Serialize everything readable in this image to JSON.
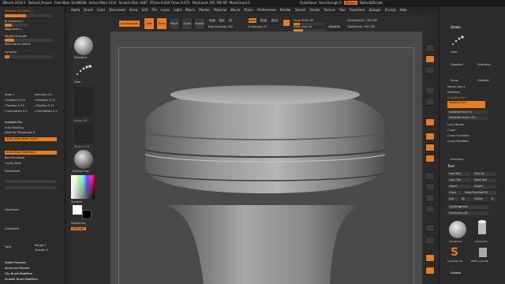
{
  "title_bar": {
    "app": "ZBrush 2018.1",
    "project": "Default_Project",
    "free_mem": "Free Mem 16.896GB",
    "active_mem": "Active Mem 7224",
    "scratch_disk": "Scratch Disk 3487",
    "timer": "ZTime 0.620 Timer 0.075",
    "polycount": "PolyCount 195.782 KP",
    "meshcount": "MeshCount 1",
    "quicksave": "QuickSave",
    "see_through": "See-through 0",
    "menus_btn": "Menus",
    "script": "DefaultZScript"
  },
  "menu_items": [
    "Alpha",
    "Brush",
    "Color",
    "Document",
    "Draw",
    "Edit",
    "File",
    "Layer",
    "Light",
    "Macro",
    "Marker",
    "Material",
    "Movie",
    "Picker",
    "Preferences",
    "Render",
    "Stencil",
    "Stroke",
    "Texture",
    "Tool",
    "Transform",
    "Zplugin",
    "Zscript",
    "Help"
  ],
  "left_panel": {
    "top_label": "Strength Multiplier 1",
    "rows": [
      {
        "text": "Brushalpha 0",
        "y": 19
      },
      {
        "text": "Magnitude 1",
        "y": 22
      },
      {
        "text": "Momentum Hold 8",
        "y": 34
      }
    ],
    "section1": "Wiggle Strength",
    "section2": "Dynamic",
    "sliders": [
      {
        "left": "Scale 1",
        "right": "Intensity 0.4"
      },
      {
        "left": "I Ambient 0.25",
        "right": "I Ambient 0.25"
      },
      {
        "left": "I Position 0.25",
        "right": "I Position 0.25"
      },
      {
        "left": "I Orientation 0.2",
        "right": "I Orientation 0.2"
      }
    ],
    "sculptris_pro": "Sculptris Pro",
    "auto_masking": "Auto Masking",
    "mask_by_polygroups": "Mask By Polygroups 0",
    "mask_mesh_insert": "Auto Mask Mesh Insert",
    "mask_fibermesh": "Auto Mask FiberMesh",
    "backface_mask": "BackFaceMask",
    "cavity_mask": "Cavity Mask",
    "directional": "Directional",
    "fibermesh": "FiberMesh",
    "colormask": "ColorMask",
    "twist_label": "Twist",
    "range_label": "Range 5",
    "smooth_label": "Smooth 5",
    "tablet_pressure": "Tablet Pressure",
    "alpha_texture": "Alpha and Texture",
    "clip_brush": "Clip Brush Modifiers",
    "smooth_brush": "Smooth Brush Modifiers"
  },
  "toolbar": {
    "home_page": "Home Page",
    "lightbox": "LightBox",
    "live_boolean": "Live Boolean",
    "edit": "Edit",
    "draw": "Draw",
    "move": "Move",
    "scale": "Scale",
    "rotate": "Rotate",
    "mrgb": "Mrgb",
    "rgb": "Rgb",
    "m": "M",
    "zadd": "Zadd",
    "zsub": "Zsub",
    "zcut": "Zcut",
    "rgb_intensity": "Rgb Intensity 100",
    "z_intensity": "Z Intensity 25",
    "focal_shift": "Focal Shift -55",
    "draw_size": "Draw Size 44",
    "dynamic": "Dynamic",
    "active_points": "ActivePoints: 195.782",
    "total_points": "TotalPoints: 195.782"
  },
  "tool_shelf": {
    "brush_name": "Standard",
    "stroke_name": "Dots",
    "alpha_name": "Alpha Off",
    "texture_name": "Texture Off",
    "material_name": "MatCap Gray",
    "gradient": "Gradient",
    "switch_color": "SwitchColor",
    "alternate": "Alternate"
  },
  "right_dock": [
    "BPR",
    "SPix 3",
    "Persp",
    "Floor",
    "Local",
    "Frame",
    "Move",
    "Zoom3D",
    "Rotate",
    "PolyF",
    "Transp",
    "Solo",
    "Xpose"
  ],
  "right_panel": {
    "stroke_title": "Stroke",
    "dots_label": "Dots",
    "drag_rect": "DragRect",
    "freehand": "FreeHand",
    "spray": "Spray",
    "dragdot": "DragDot",
    "color_label": "Color",
    "mouse_avg": "Mouse Avg 4",
    "modifiers": "Modifiers",
    "sculptris_pro": "Sculptris Pro",
    "adaptive_size": "Adaptive Size",
    "subdivision_size": "SubDivide Size 10",
    "undivision": "UnDivide Factor 1.25",
    "lazy_mouse": "Lazy Mouse",
    "curve": "Curve",
    "curve_functions": "Curve Functions",
    "curve_modifiers": "Curve Modifiers",
    "inventory": "Inventory",
    "tool_title": "Tool",
    "load_tool": "Load Tool",
    "save_as": "Save As",
    "copy_tool": "Copy Tool",
    "paste_tool": "Paste Tool",
    "import": "Import",
    "export": "Export",
    "clone": "Clone",
    "make_polymesh": "Make PolyMesh3D",
    "goz": "GoZ",
    "all": "All",
    "visible": "Visible",
    "r": "R",
    "lightbox_tools": "Lightbox▶Tools",
    "polysphere": "PolySphere_48",
    "tool_names": [
      "PolySphere",
      "Cylinder3D",
      "SimpleBrush",
      "PM3D_Cylinder"
    ],
    "subtool": "Subtool"
  },
  "colors": {
    "accent": "#e87c1e",
    "canvas": "#4a4a4a",
    "panel": "#2b2b2b"
  }
}
